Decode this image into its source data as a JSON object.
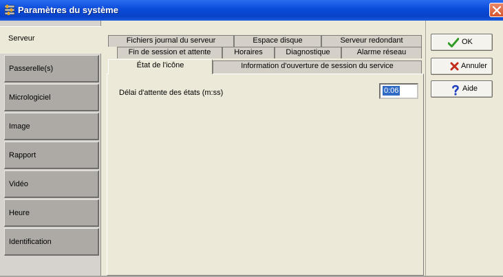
{
  "window": {
    "title": "Paramètres du système",
    "app_icon": "settings-window-icon",
    "close_icon": "close-icon"
  },
  "sidebar": {
    "items": [
      {
        "label": "Serveur",
        "active": true
      },
      {
        "label": "Passerelle(s)"
      },
      {
        "label": "Micrologiciel"
      },
      {
        "label": "Image"
      },
      {
        "label": "Rapport"
      },
      {
        "label": "Vidéo"
      },
      {
        "label": "Heure"
      },
      {
        "label": "Identification"
      }
    ]
  },
  "tabs": {
    "row1": [
      "Fichiers journal du serveur",
      "Espace disque",
      "Serveur redondant"
    ],
    "row2": [
      "Fin de session et attente",
      "Horaires",
      "Diagnostique",
      "Alarme réseau"
    ],
    "row3": [
      "État de l'icône",
      "Information d'ouverture de session du service"
    ],
    "active": "État de l'icône"
  },
  "panel": {
    "delay_label": "Délai d'attente des états (m:ss)",
    "delay_value": "0:06"
  },
  "buttons": {
    "ok": {
      "label": "OK",
      "icon": "checkmark-icon",
      "color": "#2f9a24"
    },
    "cancel": {
      "label": "Annuler",
      "icon": "x-icon",
      "color": "#c42a1a"
    },
    "help": {
      "label": "Aide",
      "icon": "question-icon",
      "color": "#1f3fbf"
    }
  }
}
